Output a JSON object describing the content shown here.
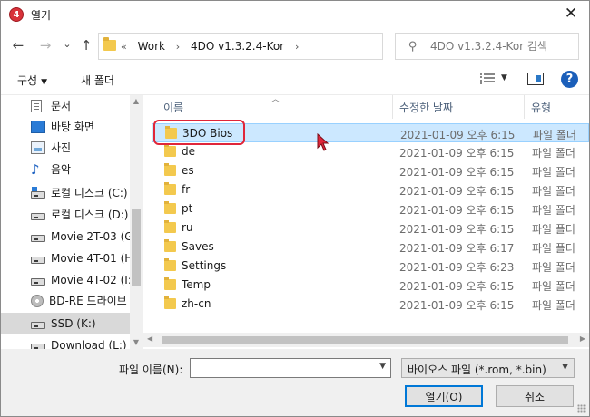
{
  "window": {
    "title": "열기",
    "app_icon_glyph": "4",
    "close_glyph": "✕"
  },
  "address": {
    "crumb_prefix": "«",
    "crumbs": [
      "Work",
      "4DO v1.3.2.4-Kor"
    ],
    "crumb_separator": "›",
    "refresh_glyph": "↻",
    "search_placeholder": "4DO v1.3.2.4-Kor 검색"
  },
  "nav_buttons": {
    "back": "←",
    "forward": "→",
    "recent": "⌄",
    "up": "↑"
  },
  "toolbar": {
    "organize": "구성",
    "new_folder": "새 폴더",
    "help": "?"
  },
  "nav_pane": {
    "items": [
      {
        "label": "문서",
        "icon": "document-icon"
      },
      {
        "label": "바탕 화면",
        "icon": "desktop-icon"
      },
      {
        "label": "사진",
        "icon": "pictures-icon"
      },
      {
        "label": "음악",
        "icon": "music-icon"
      },
      {
        "label": "로컬 디스크 (C:)",
        "icon": "windows-drive-icon"
      },
      {
        "label": "로컬 디스크 (D:)",
        "icon": "drive-icon"
      },
      {
        "label": "Movie 2T-03 (G",
        "icon": "drive-icon"
      },
      {
        "label": "Movie 4T-01 (H",
        "icon": "drive-icon"
      },
      {
        "label": "Movie 4T-02 (I:)",
        "icon": "drive-icon"
      },
      {
        "label": "BD-RE 드라이브",
        "icon": "disc-icon"
      },
      {
        "label": "SSD (K:)",
        "icon": "drive-icon",
        "selected": true
      },
      {
        "label": "Download (L:)",
        "icon": "drive-icon"
      }
    ]
  },
  "file_list": {
    "columns": {
      "name": "이름",
      "modified": "수정한 날짜",
      "type": "유형"
    },
    "rows": [
      {
        "name": "3DO Bios",
        "modified": "2021-01-09 오후 6:15",
        "type": "파일 폴더",
        "selected": true
      },
      {
        "name": "de",
        "modified": "2021-01-09 오후 6:15",
        "type": "파일 폴더"
      },
      {
        "name": "es",
        "modified": "2021-01-09 오후 6:15",
        "type": "파일 폴더"
      },
      {
        "name": "fr",
        "modified": "2021-01-09 오후 6:15",
        "type": "파일 폴더"
      },
      {
        "name": "pt",
        "modified": "2021-01-09 오후 6:15",
        "type": "파일 폴더"
      },
      {
        "name": "ru",
        "modified": "2021-01-09 오후 6:15",
        "type": "파일 폴더"
      },
      {
        "name": "Saves",
        "modified": "2021-01-09 오후 6:17",
        "type": "파일 폴더"
      },
      {
        "name": "Settings",
        "modified": "2021-01-09 오후 6:23",
        "type": "파일 폴더"
      },
      {
        "name": "Temp",
        "modified": "2021-01-09 오후 6:15",
        "type": "파일 폴더"
      },
      {
        "name": "zh-cn",
        "modified": "2021-01-09 오후 6:15",
        "type": "파일 폴더"
      }
    ]
  },
  "bottom": {
    "filename_label": "파일 이름(N):",
    "filename_value": "",
    "filetype_selected": "바이오스 파일 (*.rom, *.bin)",
    "open_button": "열기(O)",
    "cancel_button": "취소"
  },
  "colors": {
    "selection_bg": "#cce8ff",
    "annotation_ring": "#e0263a",
    "accent": "#0078d7"
  }
}
